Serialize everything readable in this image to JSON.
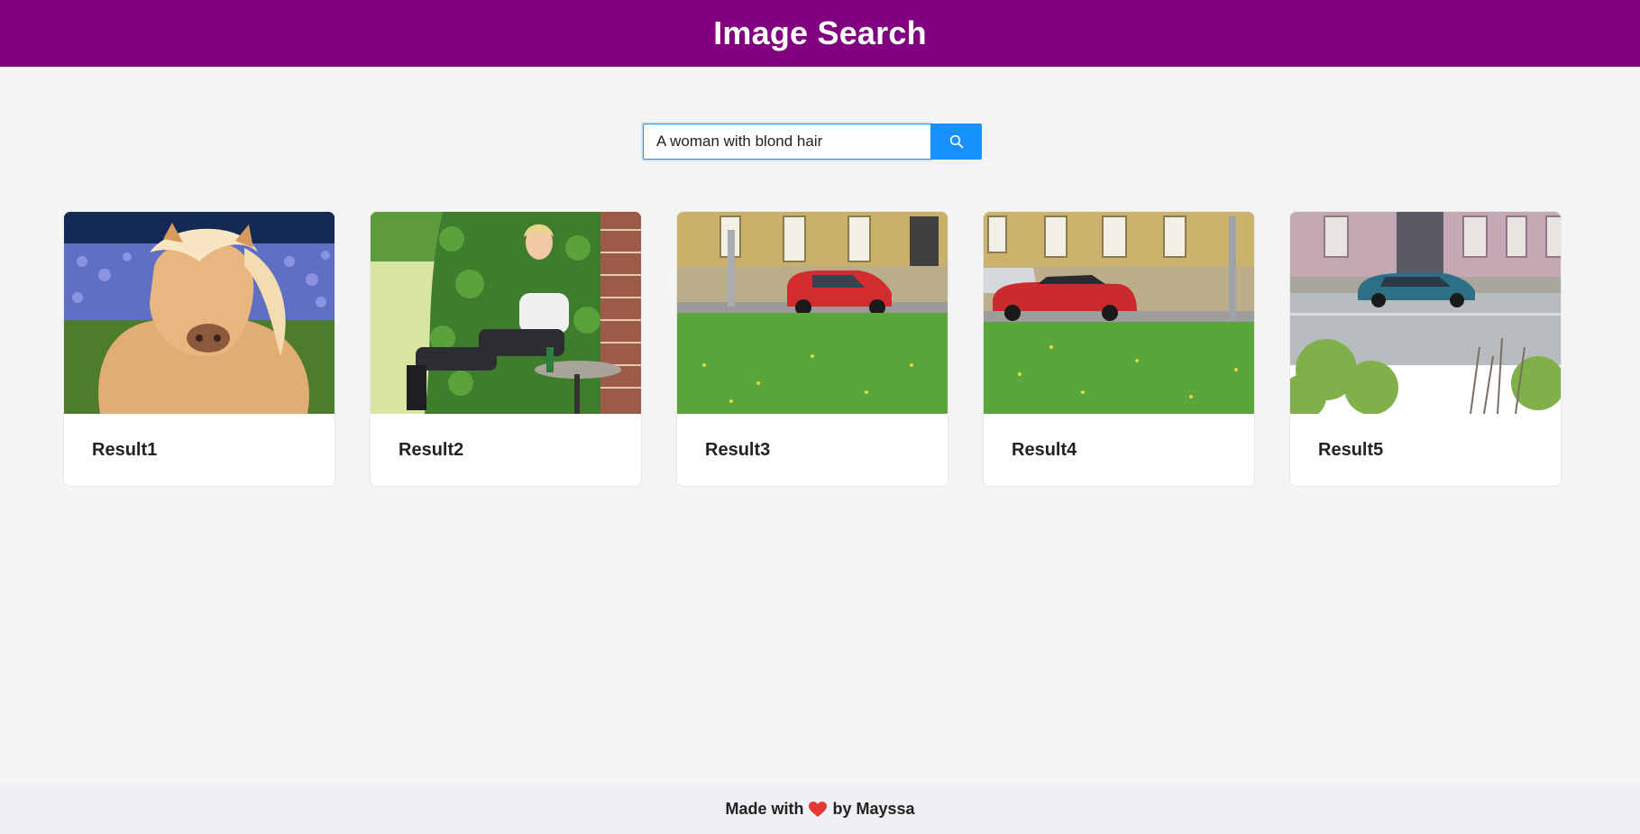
{
  "header": {
    "title": "Image Search",
    "background_color": "#800080"
  },
  "search": {
    "value": "A woman with blond hair",
    "button_icon": "search-icon",
    "accent_color": "#1890ff"
  },
  "results": [
    {
      "title": "Result1",
      "image": "palomino-pony-in-lavender-field"
    },
    {
      "title": "Result2",
      "image": "blond-woman-seated-by-ivy-wall"
    },
    {
      "title": "Result3",
      "image": "red-car-on-street-behind-grass"
    },
    {
      "title": "Result4",
      "image": "red-convertible-by-yellow-building"
    },
    {
      "title": "Result5",
      "image": "teal-sedan-on-city-street"
    }
  ],
  "footer": {
    "prefix": "Made with",
    "icon": "heart-icon",
    "suffix": "by Mayssa"
  }
}
